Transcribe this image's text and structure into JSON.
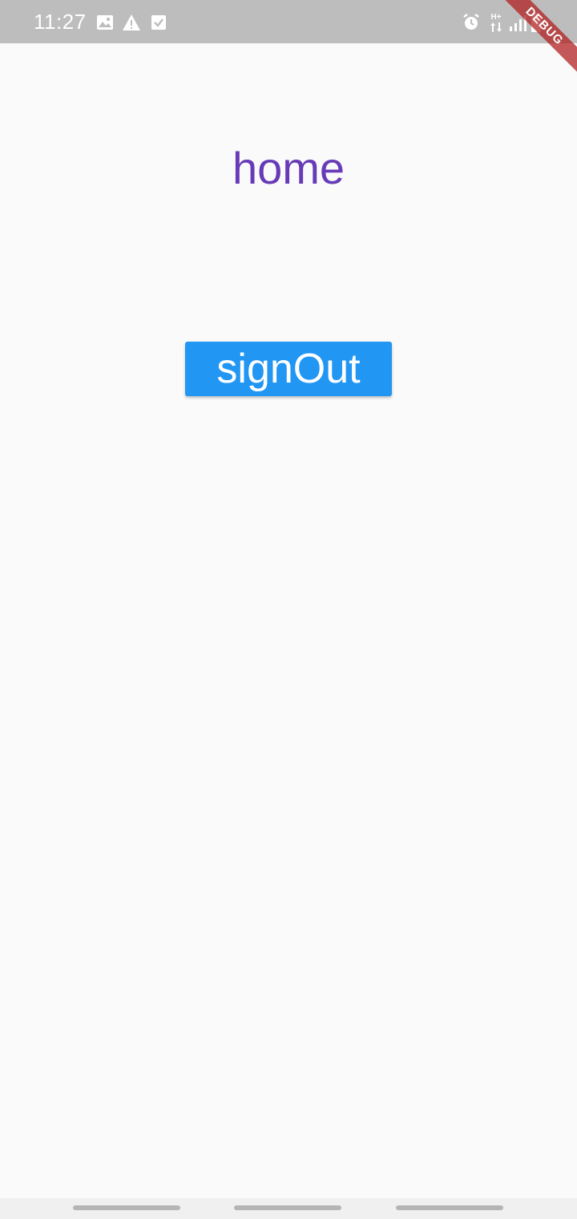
{
  "status_bar": {
    "time": "11:27",
    "left_icons": [
      "image-icon",
      "warning-icon",
      "checkbox-icon"
    ],
    "right_icons": [
      "alarm-icon",
      "network-hplus-icon",
      "signal-icon",
      "battery-icon"
    ],
    "network_label": "H+",
    "background": "#bdbdbd"
  },
  "debug_banner": {
    "label": "DEBUG",
    "color": "#b22222"
  },
  "main": {
    "title": "home",
    "title_color": "#673ab7",
    "signout_label": "signOut",
    "button_color": "#2196f3"
  },
  "nav_bar": {
    "buttons": [
      "nav-back-handle",
      "nav-home-handle",
      "nav-recents-handle"
    ]
  }
}
